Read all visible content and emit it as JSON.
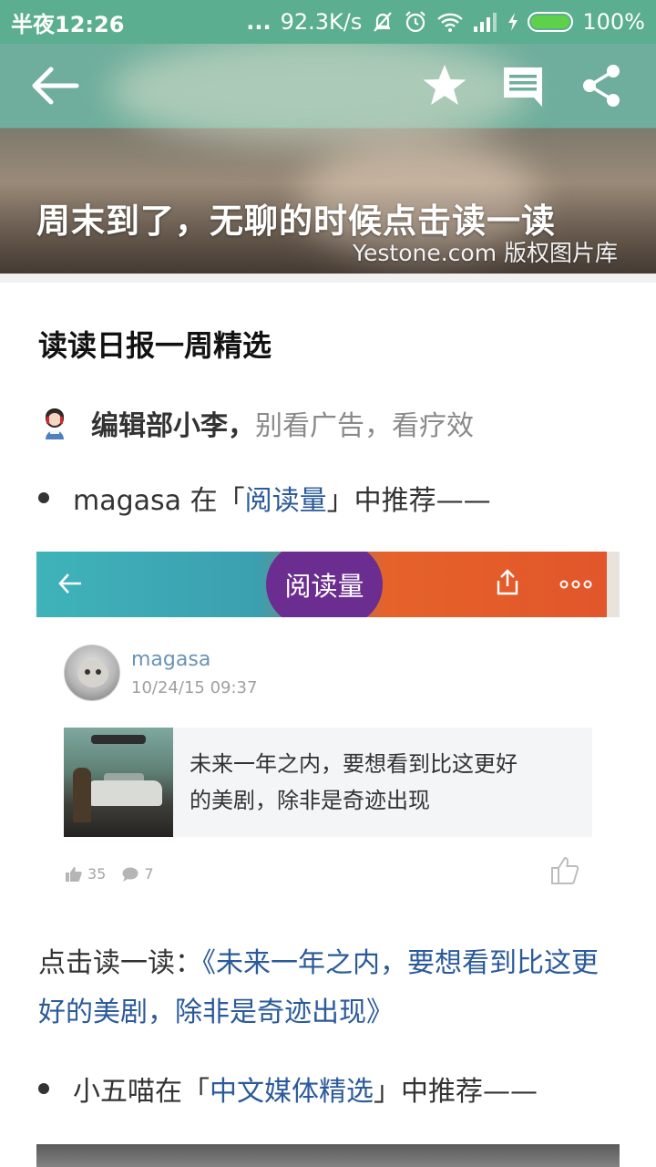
{
  "status_bar": {
    "time": "半夜12:26",
    "dots": "...",
    "network_speed": "92.3K/s",
    "battery": "100%",
    "icons": [
      "mute-bell-icon",
      "alarm-icon",
      "wifi-icon",
      "signal-icon",
      "charging-icon",
      "battery-icon"
    ]
  },
  "toolbar": {
    "icons": [
      "back-arrow-icon",
      "star-icon",
      "comment-icon",
      "share-icon"
    ]
  },
  "hero": {
    "title": "周末到了，无聊的时候点击读一读",
    "credit": "Yestone.com 版权图片库"
  },
  "article": {
    "section_title": "读读日报一周精选",
    "author": {
      "name": "编辑部小李，",
      "tagline": "别看广告，看疗效"
    },
    "recommend1": {
      "prefix": "magasa 在「",
      "link": "阅读量",
      "suffix": "」中推荐——"
    },
    "card": {
      "bar_title": "阅读量",
      "user": "magasa",
      "time": "10/24/15 09:37",
      "post_line1": "未来一年之内，要想看到比这更好",
      "post_line2": "的美剧，除非是奇迹出现",
      "likes": "35",
      "comments": "7"
    },
    "paragraph": {
      "prefix": "点击读一读：",
      "link": "《未来一年之内，要想看到比这更好的美剧，除非是奇迹出现》"
    },
    "recommend2": {
      "prefix": "小五喵在「",
      "link": "中文媒体精选",
      "suffix": "」中推荐——"
    }
  },
  "colors": {
    "status_bar_bg": "#5bae8f",
    "link": "#2b5a9b",
    "battery_fill": "#5fd04a"
  }
}
